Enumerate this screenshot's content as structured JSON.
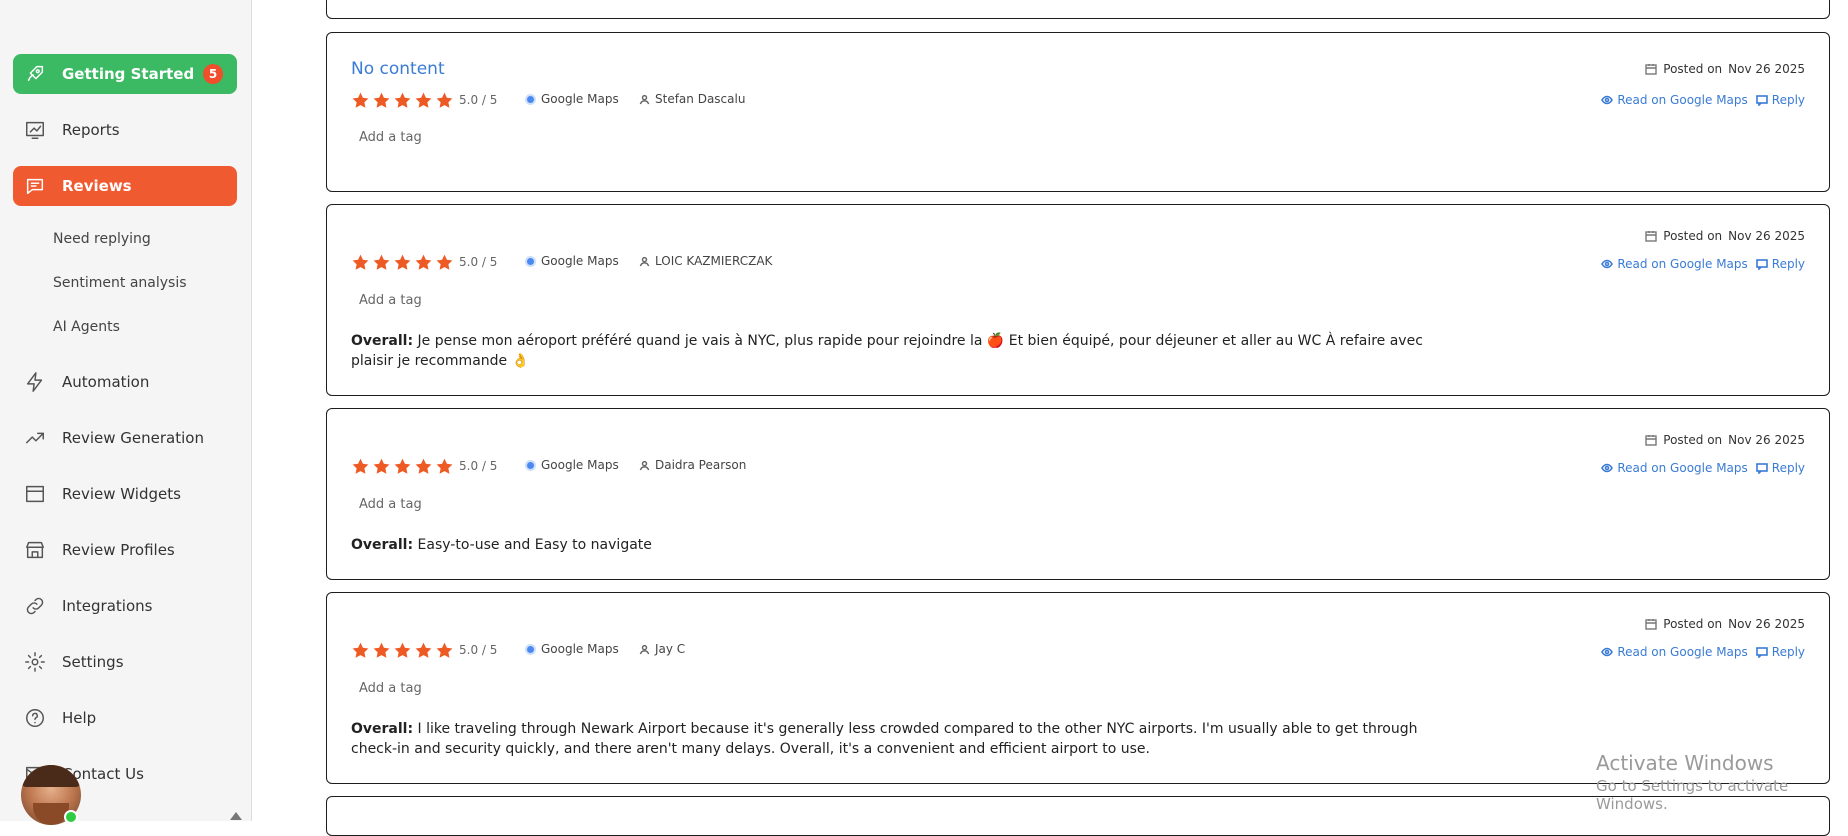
{
  "sidebar": {
    "getting_started": {
      "label": "Getting Started",
      "badge": "5",
      "icon": "rocket-icon"
    },
    "reports": {
      "label": "Reports",
      "icon": "chart-icon"
    },
    "reviews": {
      "label": "Reviews",
      "icon": "message-icon"
    },
    "sub_items": [
      "Need replying",
      "Sentiment analysis",
      "AI Agents"
    ],
    "automation": {
      "label": "Automation",
      "icon": "bolt-icon"
    },
    "review_generation": {
      "label": "Review Generation",
      "icon": "trending-icon"
    },
    "review_widgets": {
      "label": "Review Widgets",
      "icon": "window-icon"
    },
    "review_profiles": {
      "label": "Review Profiles",
      "icon": "store-icon"
    },
    "integrations": {
      "label": "Integrations",
      "icon": "link-icon"
    },
    "settings": {
      "label": "Settings",
      "icon": "gear-icon"
    },
    "help": {
      "label": "Help",
      "icon": "help-icon"
    },
    "contact_us": {
      "label": "Contact Us",
      "icon": "contact-icon"
    }
  },
  "reviews": [
    {
      "title": "No content",
      "stars": 5,
      "rating": "5.0 / 5",
      "source": "Google Maps",
      "author": "Stefan Dascalu",
      "tag_label": "Add a tag",
      "overall_label": "",
      "overall_text": "",
      "posted_label": "Posted on",
      "posted_date": "Nov 26 2025",
      "read_label": "Read on Google Maps",
      "reply_label": "Reply"
    },
    {
      "title": "",
      "stars": 5,
      "rating": "5.0 / 5",
      "source": "Google Maps",
      "author": "LOIC KAZMIERCZAK",
      "tag_label": "Add a tag",
      "overall_label": "Overall:",
      "overall_text": "Je pense mon aéroport préféré quand je vais à NYC, plus rapide pour rejoindre la 🍎 Et bien équipé, pour déjeuner et aller au WC À refaire avec plaisir je recommande 👌",
      "posted_label": "Posted on",
      "posted_date": "Nov 26 2025",
      "read_label": "Read on Google Maps",
      "reply_label": "Reply"
    },
    {
      "title": "",
      "stars": 5,
      "rating": "5.0 / 5",
      "source": "Google Maps",
      "author": "Daidra Pearson",
      "tag_label": "Add a tag",
      "overall_label": "Overall:",
      "overall_text": "Easy-to-use and Easy to navigate",
      "posted_label": "Posted on",
      "posted_date": "Nov 26 2025",
      "read_label": "Read on Google Maps",
      "reply_label": "Reply"
    },
    {
      "title": "",
      "stars": 5,
      "rating": "5.0 / 5",
      "source": "Google Maps",
      "author": "Jay C",
      "tag_label": "Add a tag",
      "overall_label": "Overall:",
      "overall_text": "I like traveling through Newark Airport because it's generally less crowded compared to the other NYC airports. I'm usually able to get through check-in and security quickly, and there aren't many delays. Overall, it's a convenient and efficient airport to use.",
      "posted_label": "Posted on",
      "posted_date": "Nov 26 2025",
      "read_label": "Read on Google Maps",
      "reply_label": "Reply"
    }
  ],
  "watermark": {
    "title": "Activate Windows",
    "subtitle": "Go to Settings to activate Windows."
  },
  "colors": {
    "green": "#3cba63",
    "orange": "#f05a30",
    "link": "#3a7bd5",
    "star": "#ee5a24"
  }
}
